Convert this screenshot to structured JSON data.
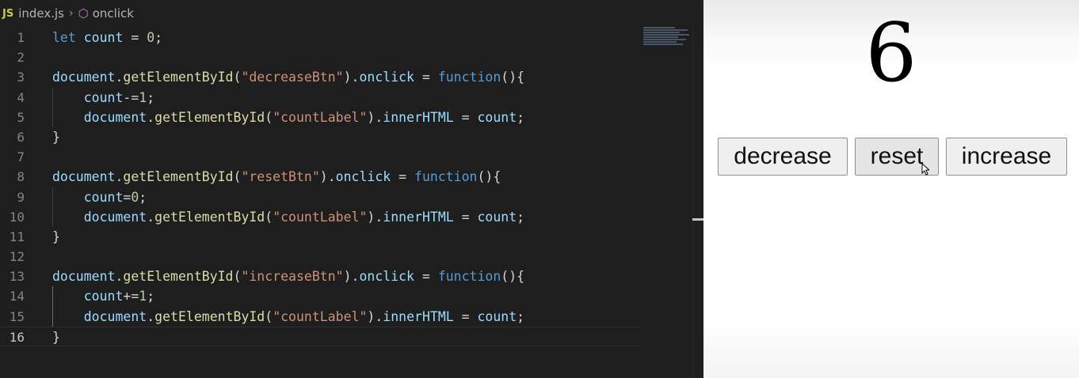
{
  "breadcrumb": {
    "lang_badge": "JS",
    "file": "index.js",
    "symbol": "onclick"
  },
  "editor": {
    "current_line": 16,
    "lines": [
      {
        "n": "1",
        "tokens": [
          [
            "kw",
            "let"
          ],
          [
            "pl",
            " "
          ],
          [
            "var",
            "count"
          ],
          [
            "pl",
            " = "
          ],
          [
            "num",
            "0"
          ],
          [
            "pl",
            ";"
          ]
        ]
      },
      {
        "n": "2",
        "tokens": []
      },
      {
        "n": "3",
        "tokens": [
          [
            "var",
            "document"
          ],
          [
            "pl",
            "."
          ],
          [
            "fn",
            "getElementById"
          ],
          [
            "pl",
            "("
          ],
          [
            "str",
            "\"decreaseBtn\""
          ],
          [
            "pl",
            ")."
          ],
          [
            "var",
            "onclick"
          ],
          [
            "pl",
            " = "
          ],
          [
            "kw",
            "function"
          ],
          [
            "pl",
            "(){"
          ]
        ]
      },
      {
        "n": "4",
        "tokens": [
          [
            "pl",
            "    "
          ],
          [
            "var",
            "count"
          ],
          [
            "pl",
            "-="
          ],
          [
            "num",
            "1"
          ],
          [
            "pl",
            ";"
          ]
        ]
      },
      {
        "n": "5",
        "tokens": [
          [
            "pl",
            "    "
          ],
          [
            "var",
            "document"
          ],
          [
            "pl",
            "."
          ],
          [
            "fn",
            "getElementById"
          ],
          [
            "pl",
            "("
          ],
          [
            "str",
            "\"countLabel\""
          ],
          [
            "pl",
            ")."
          ],
          [
            "var",
            "innerHTML"
          ],
          [
            "pl",
            " = "
          ],
          [
            "var",
            "count"
          ],
          [
            "pl",
            ";"
          ]
        ]
      },
      {
        "n": "6",
        "tokens": [
          [
            "pl",
            "}"
          ]
        ]
      },
      {
        "n": "7",
        "tokens": []
      },
      {
        "n": "8",
        "tokens": [
          [
            "var",
            "document"
          ],
          [
            "pl",
            "."
          ],
          [
            "fn",
            "getElementById"
          ],
          [
            "pl",
            "("
          ],
          [
            "str",
            "\"resetBtn\""
          ],
          [
            "pl",
            ")."
          ],
          [
            "var",
            "onclick"
          ],
          [
            "pl",
            " = "
          ],
          [
            "kw",
            "function"
          ],
          [
            "pl",
            "(){"
          ]
        ]
      },
      {
        "n": "9",
        "tokens": [
          [
            "pl",
            "    "
          ],
          [
            "var",
            "count"
          ],
          [
            "pl",
            "="
          ],
          [
            "num",
            "0"
          ],
          [
            "pl",
            ";"
          ]
        ]
      },
      {
        "n": "10",
        "tokens": [
          [
            "pl",
            "    "
          ],
          [
            "var",
            "document"
          ],
          [
            "pl",
            "."
          ],
          [
            "fn",
            "getElementById"
          ],
          [
            "pl",
            "("
          ],
          [
            "str",
            "\"countLabel\""
          ],
          [
            "pl",
            ")."
          ],
          [
            "var",
            "innerHTML"
          ],
          [
            "pl",
            " = "
          ],
          [
            "var",
            "count"
          ],
          [
            "pl",
            ";"
          ]
        ]
      },
      {
        "n": "11",
        "tokens": [
          [
            "pl",
            "}"
          ]
        ]
      },
      {
        "n": "12",
        "tokens": []
      },
      {
        "n": "13",
        "tokens": [
          [
            "var",
            "document"
          ],
          [
            "pl",
            "."
          ],
          [
            "fn",
            "getElementById"
          ],
          [
            "pl",
            "("
          ],
          [
            "str",
            "\"increaseBtn\""
          ],
          [
            "pl",
            ")."
          ],
          [
            "var",
            "onclick"
          ],
          [
            "pl",
            " = "
          ],
          [
            "kw",
            "function"
          ],
          [
            "pl",
            "(){"
          ]
        ]
      },
      {
        "n": "14",
        "tokens": [
          [
            "pl",
            "    "
          ],
          [
            "var",
            "count"
          ],
          [
            "pl",
            "+="
          ],
          [
            "num",
            "1"
          ],
          [
            "pl",
            ";"
          ]
        ]
      },
      {
        "n": "15",
        "tokens": [
          [
            "pl",
            "    "
          ],
          [
            "var",
            "document"
          ],
          [
            "pl",
            "."
          ],
          [
            "fn",
            "getElementById"
          ],
          [
            "pl",
            "("
          ],
          [
            "str",
            "\"countLabel\""
          ],
          [
            "pl",
            ")."
          ],
          [
            "var",
            "innerHTML"
          ],
          [
            "pl",
            " = "
          ],
          [
            "var",
            "count"
          ],
          [
            "pl",
            ";"
          ]
        ]
      },
      {
        "n": "16",
        "tokens": [
          [
            "pl",
            "}"
          ]
        ]
      }
    ]
  },
  "preview": {
    "count": "6",
    "buttons": {
      "decrease": "decrease",
      "reset": "reset",
      "increase": "increase"
    }
  }
}
